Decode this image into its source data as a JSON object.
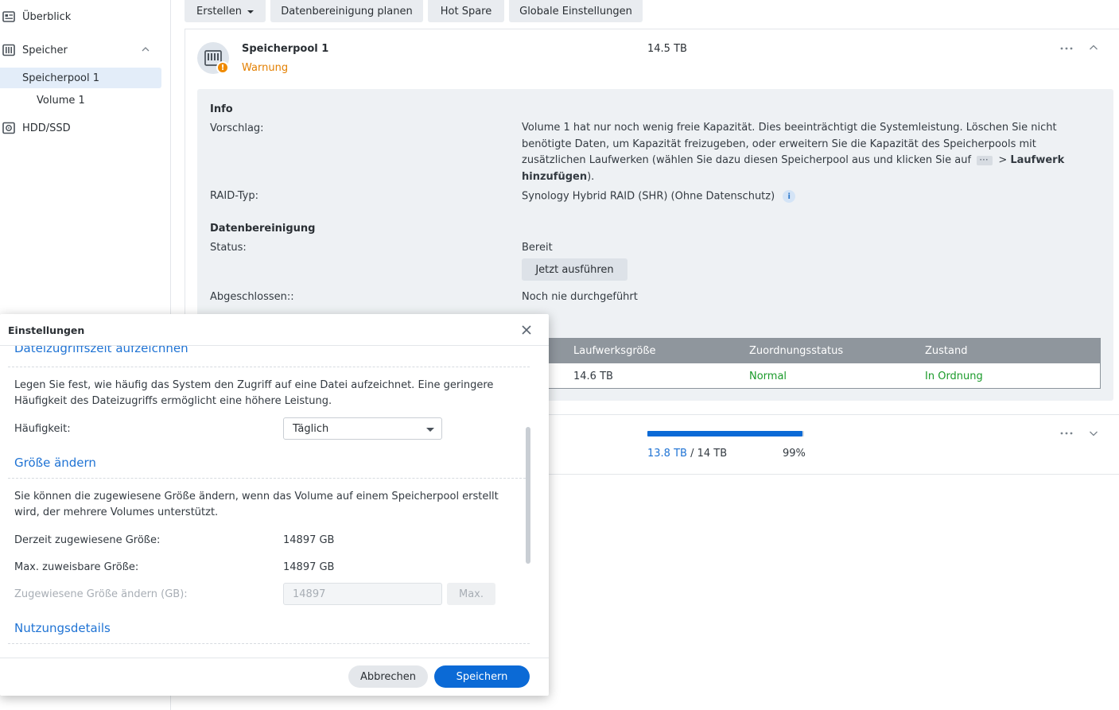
{
  "sidebar": {
    "items": [
      {
        "label": "Überblick",
        "icon": "overview-icon"
      },
      {
        "label": "Speicher",
        "icon": "storage-icon"
      },
      {
        "label": "Speicherpool 1"
      },
      {
        "label": "Volume 1"
      },
      {
        "label": "HDD/SSD",
        "icon": "hdd-icon"
      }
    ]
  },
  "toolbar": {
    "create": "Erstellen",
    "scrub_schedule": "Datenbereinigung planen",
    "hot_spare": "Hot Spare",
    "global_settings": "Globale Einstellungen"
  },
  "pool": {
    "title": "Speicherpool 1",
    "status": "Warnung",
    "size": "14.5 TB",
    "info": {
      "section": "Info",
      "suggestion_label": "Vorschlag:",
      "suggestion_text": "Volume 1 hat nur noch wenig freie Kapazität. Dies beeinträchtigt die Systemleistung. Löschen Sie nicht benötigte Daten, um Kapazität freizugeben, oder erweitern Sie die Kapazität des Speicherpools mit zusätzlichen Laufwerken (wählen Sie dazu diesen Speicherpool aus und klicken Sie auf",
      "suggestion_arrow": " > ",
      "suggestion_bold": "Laufwerk hinzufügen",
      "suggestion_end": ").",
      "raid_label": "RAID-Typ:",
      "raid_value": "Synology Hybrid RAID (SHR) (Ohne Datenschutz)"
    },
    "scrub": {
      "section": "Datenbereinigung",
      "status_label": "Status:",
      "status_value": "Bereit",
      "run_now": "Jetzt ausführen",
      "completed_label": "Abgeschlossen::",
      "completed_value": "Noch nie durchgeführt"
    },
    "drives": {
      "headers": [
        "Laufwerksgröße",
        "Zuordnungsstatus",
        "Zustand"
      ],
      "rows": [
        {
          "size": "14.6 TB",
          "allocation": "Normal",
          "health": "In Ordnung"
        }
      ]
    }
  },
  "volume": {
    "used": "13.8 TB",
    "separator": "/",
    "total": "14 TB",
    "percent": "99%",
    "usage_fraction": 0.99
  },
  "dialog": {
    "title": "Einstellungen",
    "access_section": "Dateizugriffszeit aufzeichnen",
    "access_desc": "Legen Sie fest, wie häufig das System den Zugriff auf eine Datei aufzeichnet. Eine geringere Häufigkeit des Dateizugriffs ermöglicht eine höhere Leistung.",
    "frequency_label": "Häufigkeit:",
    "frequency_value": "Täglich",
    "resize_section": "Größe ändern",
    "resize_desc": "Sie können die zugewiesene Größe ändern, wenn das Volume auf einem Speicherpool erstellt wird, der mehrere Volumes unterstützt.",
    "current_label": "Derzeit zugewiesene Größe:",
    "current_value": "14897 GB",
    "max_label": "Max. zuweisbare Größe:",
    "max_value": "14897 GB",
    "change_label": "Zugewiesene Größe ändern (GB):",
    "change_value": "14897",
    "max_button": "Max.",
    "usage_section": "Nutzungsdetails",
    "cancel": "Abbrechen",
    "save": "Speichern"
  },
  "colors": {
    "accent": "#0b6ad6",
    "warning": "#e37f00",
    "ok": "#1a9a2a"
  }
}
